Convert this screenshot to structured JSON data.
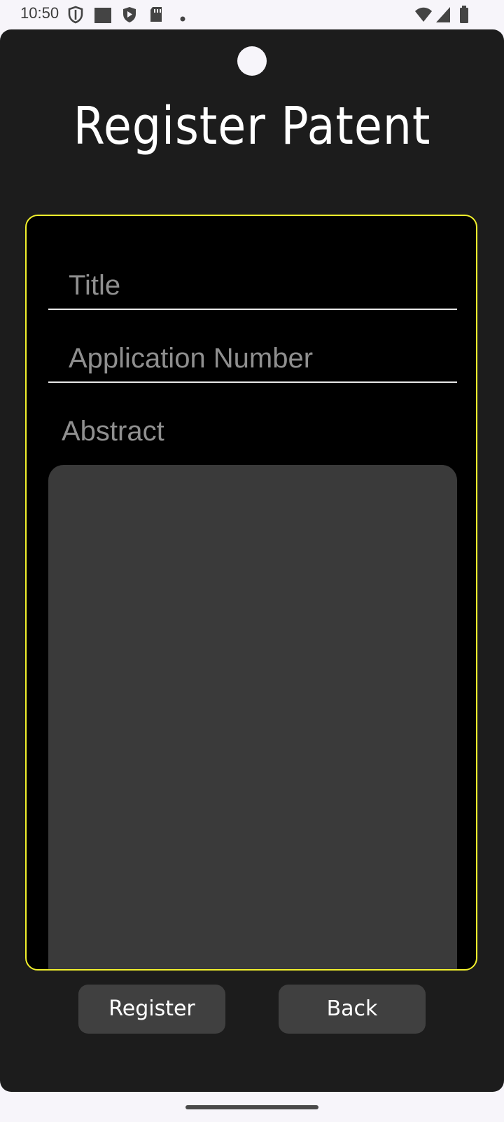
{
  "status_bar": {
    "time": "10:50",
    "left_icons": [
      "shield-outline-icon",
      "square-icon",
      "play-shield-icon",
      "sd-card-icon",
      "dot-icon"
    ],
    "right_icons": [
      "wifi-icon",
      "cellular-signal-icon",
      "battery-icon"
    ]
  },
  "page": {
    "title": "Register Patent"
  },
  "form": {
    "title_placeholder": "Title",
    "application_number_placeholder": "Application Number",
    "abstract_label": "Abstract",
    "abstract_value": ""
  },
  "buttons": {
    "register_label": "Register",
    "back_label": "Back"
  },
  "colors": {
    "card_border": "#f1f02c",
    "background": "#1c1c1c",
    "card_background": "#000000",
    "abstract_background": "#3a3a3a",
    "button_background": "#404040"
  }
}
